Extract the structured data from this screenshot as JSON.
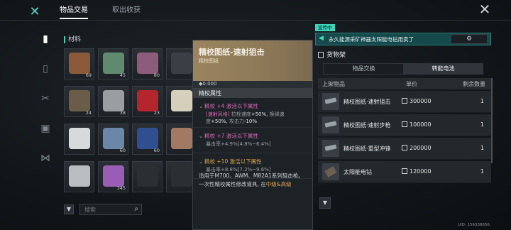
{
  "top_tabs": {
    "trade": "物品交易",
    "collect": "取出收获"
  },
  "materials": {
    "title": "材料",
    "items": [
      {
        "count": "69",
        "color": "#8b5a3a"
      },
      {
        "count": "45",
        "color": "#5f8a6e"
      },
      {
        "count": "80",
        "color": "#8e5c7b"
      },
      {
        "count": "",
        "color": "#3a3f45"
      },
      {
        "count": "24",
        "color": "#6b5c4a"
      },
      {
        "count": "38",
        "color": "#9a9ea2"
      },
      {
        "count": "23",
        "color": "#b3262b"
      },
      {
        "count": "",
        "color": "#d6cfbb"
      },
      {
        "count": "",
        "color": "#d7d9db"
      },
      {
        "count": "60",
        "color": "#6a87a8"
      },
      {
        "count": "60",
        "color": "#2f4f91"
      },
      {
        "count": "",
        "color": "#a27a63"
      },
      {
        "count": "",
        "color": "#b9bec2"
      },
      {
        "count": "345",
        "color": "#9a5db5"
      },
      {
        "count": "",
        "color": "#2a2f34"
      },
      {
        "count": "",
        "color": "#2a2f34"
      }
    ],
    "search_placeholder": "搜索"
  },
  "popup": {
    "title": "精校图纸-速射狙击",
    "subtitle": "精校图纸",
    "value": "0.000",
    "attr_title": "精校属性",
    "attrs": [
      {
        "line1": "精校 +4 激活以下属性",
        "line2a": "[速射风格]",
        "line2b": " 拉栓速度",
        "line2c": "+50%,",
        "line2d": " 换弹速",
        "line3a": "度",
        "line3b": "+50%,",
        "line3c": " 攻击力",
        "line3d": "-10%"
      },
      {
        "line1": "精校 +7 激活以下属性",
        "line2a": "暴击率",
        "line2b": "+4.9%",
        "line2c": "[4.8%~6.4%]"
      },
      {
        "line1": "精校 +10 激活以下属性",
        "line2a": "暴击率",
        "line2b": "+8.8%",
        "line2c": "[7.2%~9.6%]"
      }
    ],
    "desc1": "适用于M700、AWM、M82A1系列狙击枪。",
    "desc2a": "一次性精校属性修改道具, 在",
    "desc2b": "中级&高级"
  },
  "promo": {
    "tag": "宣传中",
    "text": "永久能源采矿神器太阳能电钻用卖了"
  },
  "shelf": {
    "title": "货物架",
    "tab_exchange": "物品交换",
    "tab_battery": "转能电池",
    "col_item": "上架物品",
    "col_price": "单价",
    "col_qty": "剩余数量",
    "rows": [
      {
        "name": "精校图纸·速射狙击",
        "price": "300000",
        "qty": "1"
      },
      {
        "name": "精校图纸·速射步枪",
        "price": "100000",
        "qty": "1"
      },
      {
        "name": "精校图纸·重型冲锋",
        "price": "200000",
        "qty": "1"
      },
      {
        "name": "太阳能电钻",
        "price": "120000",
        "qty": "1"
      }
    ]
  },
  "uid": "UID: 156338656"
}
